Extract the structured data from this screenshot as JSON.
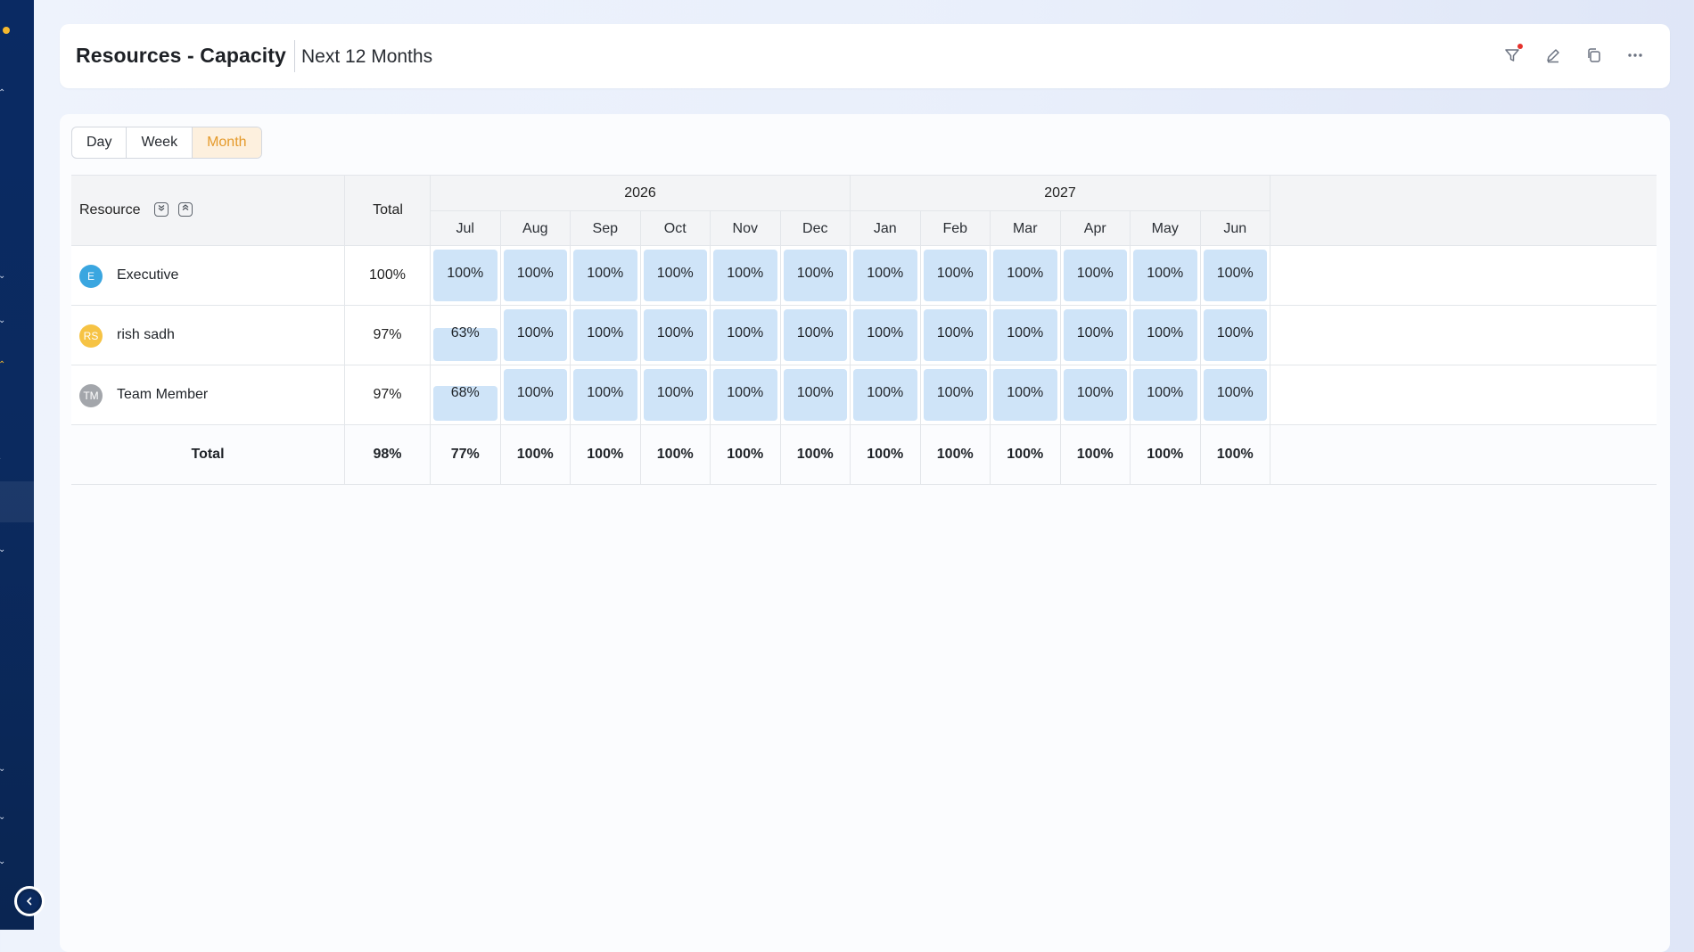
{
  "header": {
    "title": "Resources - Capacity",
    "subtitle": "Next 12 Months",
    "icons": [
      "filter-icon",
      "edit-icon",
      "copy-icon",
      "more-icon"
    ]
  },
  "view_toggle": {
    "options": [
      "Day",
      "Week",
      "Month"
    ],
    "selected": "Month"
  },
  "grid": {
    "resource_header": "Resource",
    "total_header": "Total",
    "years": [
      "2026",
      "2027"
    ],
    "months": [
      "Jul",
      "Aug",
      "Sep",
      "Oct",
      "Nov",
      "Dec",
      "Jan",
      "Feb",
      "Mar",
      "Apr",
      "May",
      "Jun"
    ],
    "rows": [
      {
        "initials": "E",
        "avatar_color": "#3aa6e0",
        "name": "Executive",
        "total": "100%",
        "values": [
          "100%",
          "100%",
          "100%",
          "100%",
          "100%",
          "100%",
          "100%",
          "100%",
          "100%",
          "100%",
          "100%",
          "100%"
        ],
        "fill": [
          1,
          1,
          1,
          1,
          1,
          1,
          1,
          1,
          1,
          1,
          1,
          1
        ]
      },
      {
        "initials": "RS",
        "avatar_color": "#f6c344",
        "name": "rish sadh",
        "total": "97%",
        "values": [
          "63%",
          "100%",
          "100%",
          "100%",
          "100%",
          "100%",
          "100%",
          "100%",
          "100%",
          "100%",
          "100%",
          "100%"
        ],
        "fill": [
          0.63,
          1,
          1,
          1,
          1,
          1,
          1,
          1,
          1,
          1,
          1,
          1
        ]
      },
      {
        "initials": "TM",
        "avatar_color": "#a3a6ab",
        "name": "Team Member",
        "total": "97%",
        "values": [
          "68%",
          "100%",
          "100%",
          "100%",
          "100%",
          "100%",
          "100%",
          "100%",
          "100%",
          "100%",
          "100%",
          "100%"
        ],
        "fill": [
          0.68,
          1,
          1,
          1,
          1,
          1,
          1,
          1,
          1,
          1,
          1,
          1
        ]
      }
    ],
    "totals": {
      "label": "Total",
      "total": "98%",
      "values": [
        "77%",
        "100%",
        "100%",
        "100%",
        "100%",
        "100%",
        "100%",
        "100%",
        "100%",
        "100%",
        "100%",
        "100%"
      ]
    }
  },
  "colors": {
    "accent": "#e59a2b",
    "capacity_fill": "#cfe4f8",
    "sidebar": "#0a2a63"
  }
}
